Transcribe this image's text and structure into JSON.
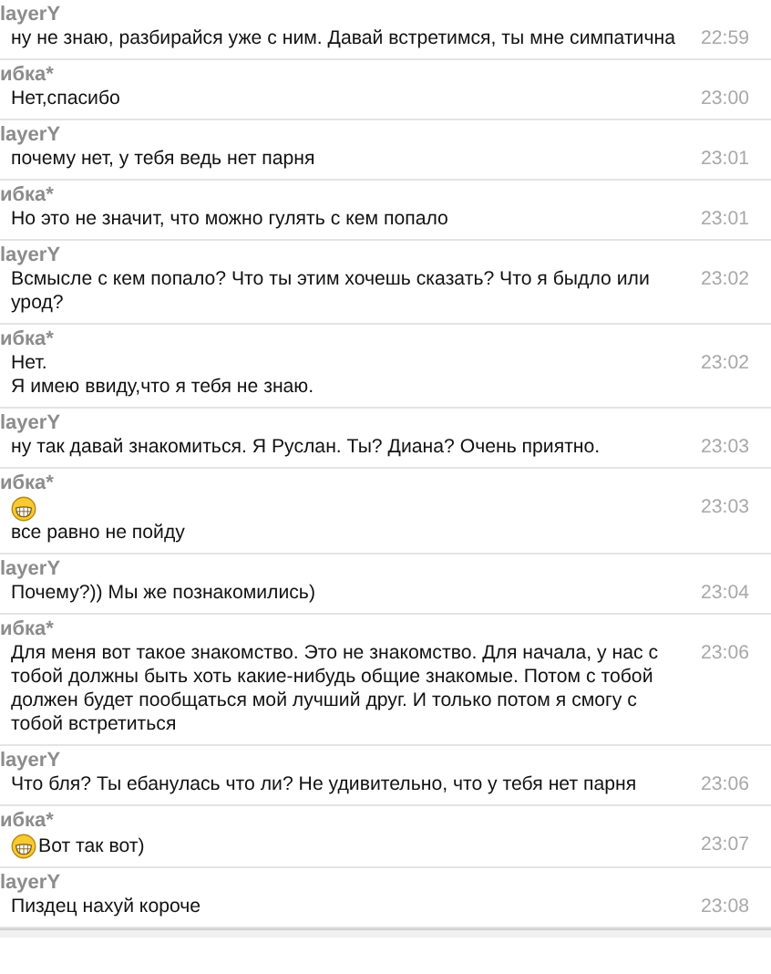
{
  "messages": [
    {
      "sender": "layerY",
      "time": "22:59",
      "lines": [
        {
          "text": "ну не знаю, разбирайся уже с ним. Давай встретимся, ты мне симпатична"
        }
      ]
    },
    {
      "sender": "ибка*",
      "time": "23:00",
      "lines": [
        {
          "text": "Нет,спасибо"
        }
      ]
    },
    {
      "sender": "layerY",
      "time": "23:01",
      "lines": [
        {
          "text": "почему нет, у тебя ведь нет парня"
        }
      ]
    },
    {
      "sender": "ибка*",
      "time": "23:01",
      "lines": [
        {
          "text": "Но это не значит, что можно гулять с кем попало"
        }
      ]
    },
    {
      "sender": "layerY",
      "time": "23:02",
      "lines": [
        {
          "text": "Всмысле с кем попало? Что ты этим хочешь сказать? Что я быдло или"
        },
        {
          "text": "урод?"
        }
      ]
    },
    {
      "sender": "ибка*",
      "time": "23:02",
      "lines": [
        {
          "text": "Нет."
        },
        {
          "text": "Я имею ввиду,что я тебя не знаю."
        }
      ]
    },
    {
      "sender": "layerY",
      "time": "23:03",
      "lines": [
        {
          "text": "ну так давай знакомиться. Я Руслан. Ты? Диана? Очень приятно."
        }
      ]
    },
    {
      "sender": "ибка*",
      "time": "23:03",
      "lines": [
        {
          "smiley": true
        },
        {
          "text": "все равно не пойду"
        }
      ]
    },
    {
      "sender": "layerY",
      "time": "23:04",
      "lines": [
        {
          "text": "Почему?)) Мы же познакомились)"
        }
      ]
    },
    {
      "sender": "ибка*",
      "time": "23:06",
      "lines": [
        {
          "text": "Для меня вот такое знакомство. Это не знакомство. Для начала, у нас с"
        },
        {
          "text": "тобой должны быть хоть какие-нибудь общие знакомые. Потом с тобой"
        },
        {
          "text": "должен будет пообщаться мой лучший друг. И только потом я смогу с"
        },
        {
          "text": "тобой встретиться"
        }
      ]
    },
    {
      "sender": "layerY",
      "time": "23:06",
      "lines": [
        {
          "text": "Что бля? Ты ебанулась что ли? Не удивительно, что у тебя нет парня"
        }
      ]
    },
    {
      "sender": "ибка*",
      "time": "23:07",
      "lines": [
        {
          "smiley": true,
          "text": "Вот так вот)"
        }
      ]
    },
    {
      "sender": "layerY",
      "time": "23:08",
      "lines": [
        {
          "text": "Пиздец нахуй короче"
        }
      ]
    }
  ]
}
